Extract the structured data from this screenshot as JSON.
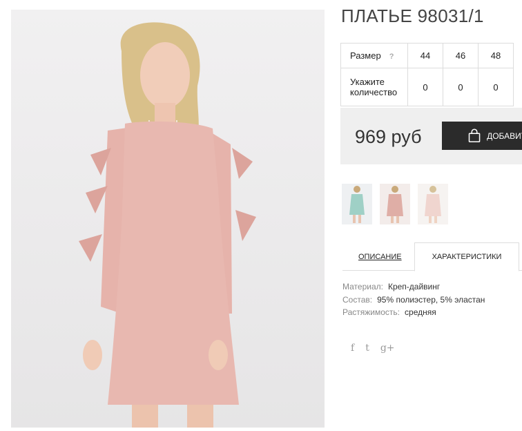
{
  "product": {
    "title": "ПЛАТЬЕ 98031/1"
  },
  "size_table": {
    "size_label": "Размер",
    "help_mark": "?",
    "sizes": [
      "44",
      "46",
      "48"
    ],
    "qty_label_line1": "Укажите",
    "qty_label_line2": "количество",
    "quantities": [
      "0",
      "0",
      "0"
    ]
  },
  "purchase": {
    "price": "969 руб",
    "add_button_label": "ДОБАВИТЬ"
  },
  "gallery": {
    "thumbnails": [
      "mint-dress-thumb",
      "pink-dress-thumb",
      "light-pink-dress-thumb"
    ]
  },
  "tabs": {
    "description": "ОПИСАНИЕ",
    "characteristics": "ХАРАКТЕРИСТИКИ"
  },
  "specs": [
    {
      "key": "Материал:",
      "value": "Креп-дайвинг"
    },
    {
      "key": "Состав:",
      "value": "95% полиэстер, 5% эластан"
    },
    {
      "key": "Растяжимость:",
      "value": "средняя"
    }
  ],
  "social": {
    "facebook": "f",
    "twitter": "t",
    "googleplus": "g+"
  },
  "colors": {
    "dress": "#e8b8b0",
    "button": "#2b2b2b",
    "price_bg": "#efefef"
  }
}
